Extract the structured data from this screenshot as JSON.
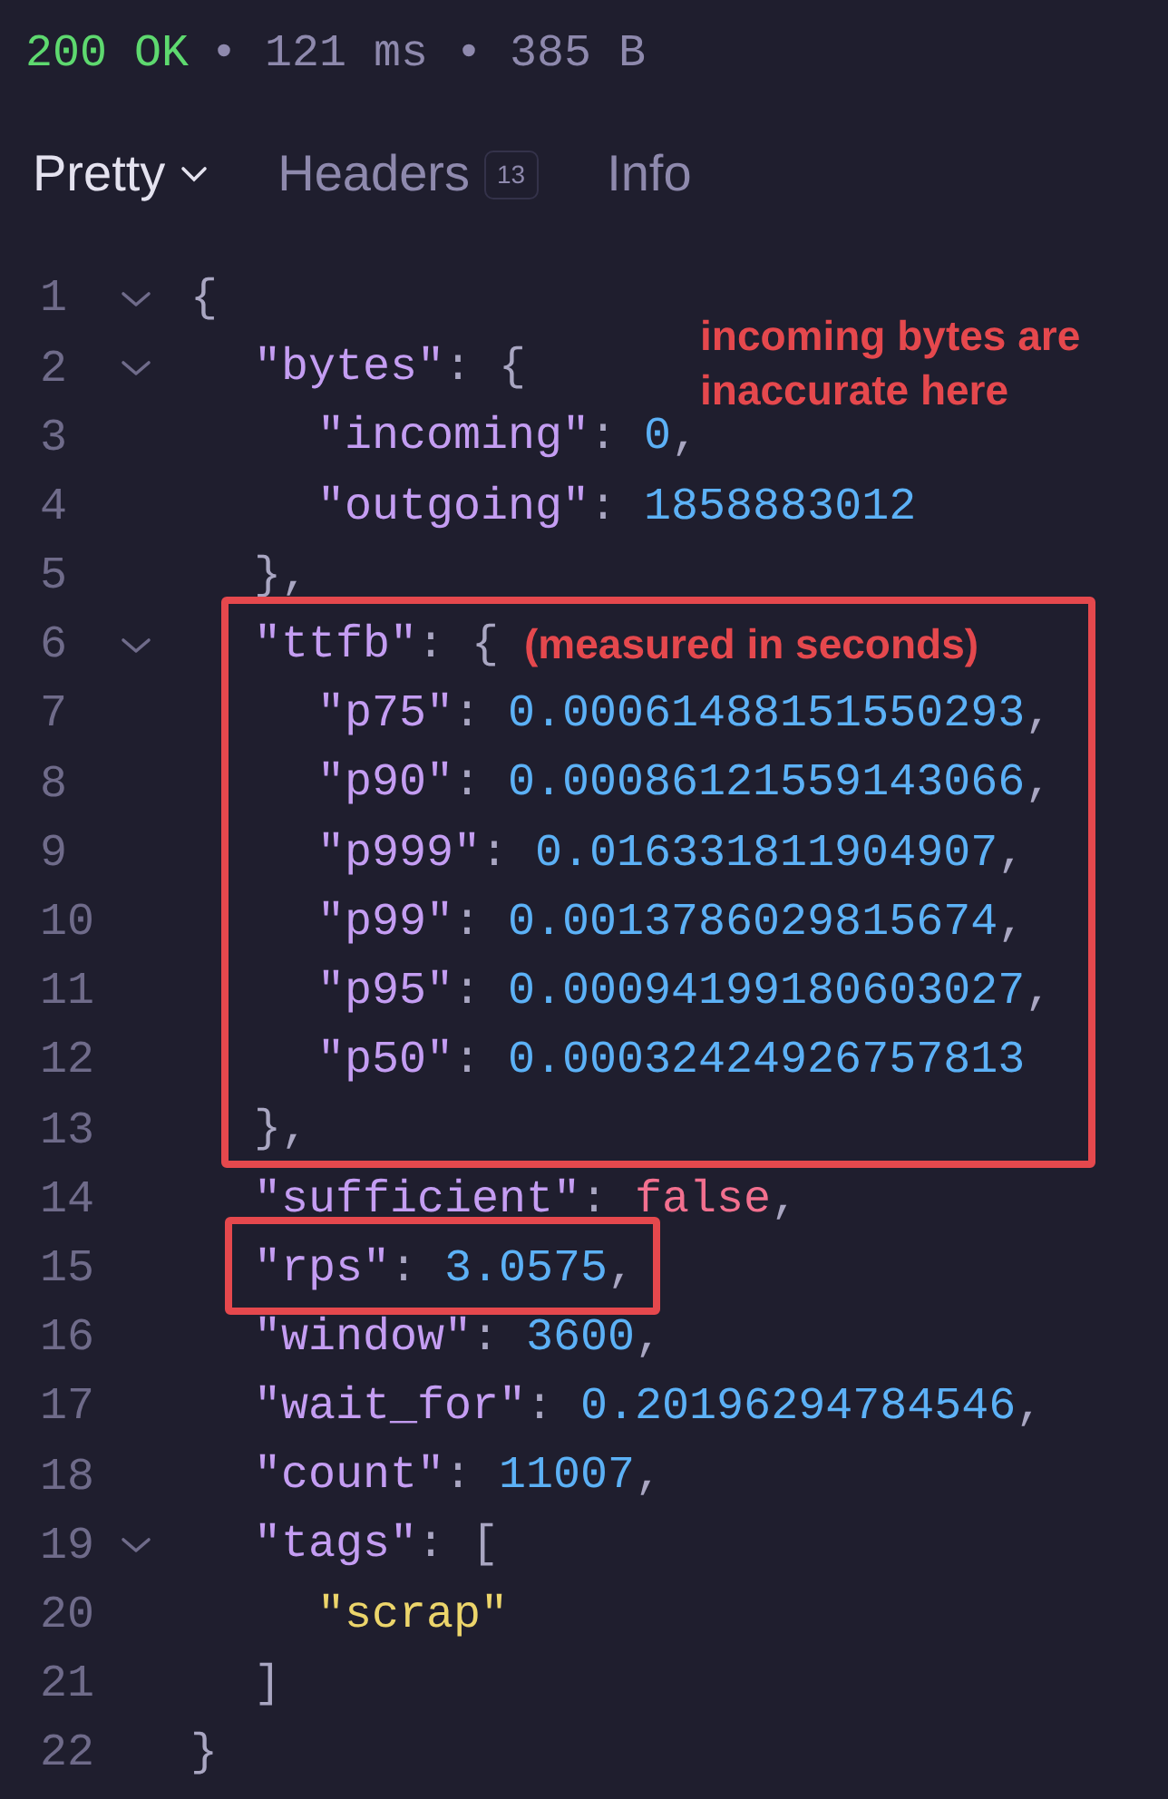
{
  "status": {
    "code": "200 OK",
    "details": "• 121 ms • 385 B"
  },
  "tabs": [
    {
      "label": "Pretty",
      "selected": true,
      "dropdown": true
    },
    {
      "label": "Headers",
      "selected": false,
      "badge": "13"
    },
    {
      "label": "Info",
      "selected": false
    }
  ],
  "code": [
    {
      "number": "1",
      "expanded": true,
      "tokens": [
        {
          "kind": "punct",
          "text": "{"
        }
      ],
      "children": [
        {
          "number": "2",
          "expanded": true,
          "tokens": [
            {
              "kind": "key",
              "text": "\"bytes\""
            },
            {
              "kind": "punct",
              "text": ": {"
            }
          ],
          "children": [
            {
              "number": "3",
              "tokens": [
                {
                  "kind": "key",
                  "text": "\"incoming\""
                },
                {
                  "kind": "punct",
                  "text": ": "
                },
                {
                  "kind": "number",
                  "text": "0"
                },
                {
                  "kind": "punct",
                  "text": ","
                }
              ]
            },
            {
              "number": "4",
              "tokens": [
                {
                  "kind": "key",
                  "text": "\"outgoing\""
                },
                {
                  "kind": "punct",
                  "text": ": "
                },
                {
                  "kind": "number",
                  "text": "1858883012"
                }
              ]
            }
          ]
        },
        {
          "number": "5",
          "tokens": [
            {
              "kind": "punct",
              "text": "},"
            }
          ]
        },
        {
          "number": "6",
          "expanded": true,
          "tokens": [
            {
              "kind": "key",
              "text": "\"ttfb\""
            },
            {
              "kind": "punct",
              "text": ": {"
            }
          ],
          "children": [
            {
              "number": "7",
              "tokens": [
                {
                  "kind": "key",
                  "text": "\"p75\""
                },
                {
                  "kind": "punct",
                  "text": ": "
                },
                {
                  "kind": "number",
                  "text": "0.00061488151550293"
                },
                {
                  "kind": "punct",
                  "text": ","
                }
              ]
            },
            {
              "number": "8",
              "tokens": [
                {
                  "kind": "key",
                  "text": "\"p90\""
                },
                {
                  "kind": "punct",
                  "text": ": "
                },
                {
                  "kind": "number",
                  "text": "0.00086121559143066"
                },
                {
                  "kind": "punct",
                  "text": ","
                }
              ]
            },
            {
              "number": "9",
              "tokens": [
                {
                  "kind": "key",
                  "text": "\"p999\""
                },
                {
                  "kind": "punct",
                  "text": ": "
                },
                {
                  "kind": "number",
                  "text": "0.016331811904907"
                },
                {
                  "kind": "punct",
                  "text": ","
                }
              ]
            },
            {
              "number": "10",
              "tokens": [
                {
                  "kind": "key",
                  "text": "\"p99\""
                },
                {
                  "kind": "punct",
                  "text": ": "
                },
                {
                  "kind": "number",
                  "text": "0.0013786029815674"
                },
                {
                  "kind": "punct",
                  "text": ","
                }
              ]
            },
            {
              "number": "11",
              "tokens": [
                {
                  "kind": "key",
                  "text": "\"p95\""
                },
                {
                  "kind": "punct",
                  "text": ": "
                },
                {
                  "kind": "number",
                  "text": "0.00094199180603027"
                },
                {
                  "kind": "punct",
                  "text": ","
                }
              ]
            },
            {
              "number": "12",
              "tokens": [
                {
                  "kind": "key",
                  "text": "\"p50\""
                },
                {
                  "kind": "punct",
                  "text": ": "
                },
                {
                  "kind": "number",
                  "text": "0.00032424926757813"
                }
              ]
            }
          ]
        },
        {
          "number": "13",
          "tokens": [
            {
              "kind": "punct",
              "text": "},"
            }
          ]
        },
        {
          "number": "14",
          "tokens": [
            {
              "kind": "key",
              "text": "\"sufficient\""
            },
            {
              "kind": "punct",
              "text": ": "
            },
            {
              "kind": "bool",
              "text": "false"
            },
            {
              "kind": "punct",
              "text": ","
            }
          ]
        },
        {
          "number": "15",
          "tokens": [
            {
              "kind": "key",
              "text": "\"rps\""
            },
            {
              "kind": "punct",
              "text": ": "
            },
            {
              "kind": "number",
              "text": "3.0575"
            },
            {
              "kind": "punct",
              "text": ","
            }
          ]
        },
        {
          "number": "16",
          "tokens": [
            {
              "kind": "key",
              "text": "\"window\""
            },
            {
              "kind": "punct",
              "text": ": "
            },
            {
              "kind": "number",
              "text": "3600"
            },
            {
              "kind": "punct",
              "text": ","
            }
          ]
        },
        {
          "number": "17",
          "tokens": [
            {
              "kind": "key",
              "text": "\"wait_for\""
            },
            {
              "kind": "punct",
              "text": ": "
            },
            {
              "kind": "number",
              "text": "0.20196294784546"
            },
            {
              "kind": "punct",
              "text": ","
            }
          ]
        },
        {
          "number": "18",
          "tokens": [
            {
              "kind": "key",
              "text": "\"count\""
            },
            {
              "kind": "punct",
              "text": ": "
            },
            {
              "kind": "number",
              "text": "11007"
            },
            {
              "kind": "punct",
              "text": ","
            }
          ]
        },
        {
          "number": "19",
          "expanded": true,
          "tokens": [
            {
              "kind": "key",
              "text": "\"tags\""
            },
            {
              "kind": "punct",
              "text": ": ["
            }
          ],
          "children": [
            {
              "number": "20",
              "tokens": [
                {
                  "kind": "string",
                  "text": "\"scrap\""
                }
              ]
            }
          ]
        },
        {
          "number": "21",
          "tokens": [
            {
              "kind": "punct",
              "text": "]"
            }
          ]
        }
      ]
    },
    {
      "number": "22",
      "tokens": [
        {
          "kind": "punct",
          "text": "}"
        }
      ]
    }
  ],
  "annotations": [
    {
      "text": "incoming bytes are inaccurate here"
    },
    {
      "text": "(measured in seconds)"
    }
  ]
}
